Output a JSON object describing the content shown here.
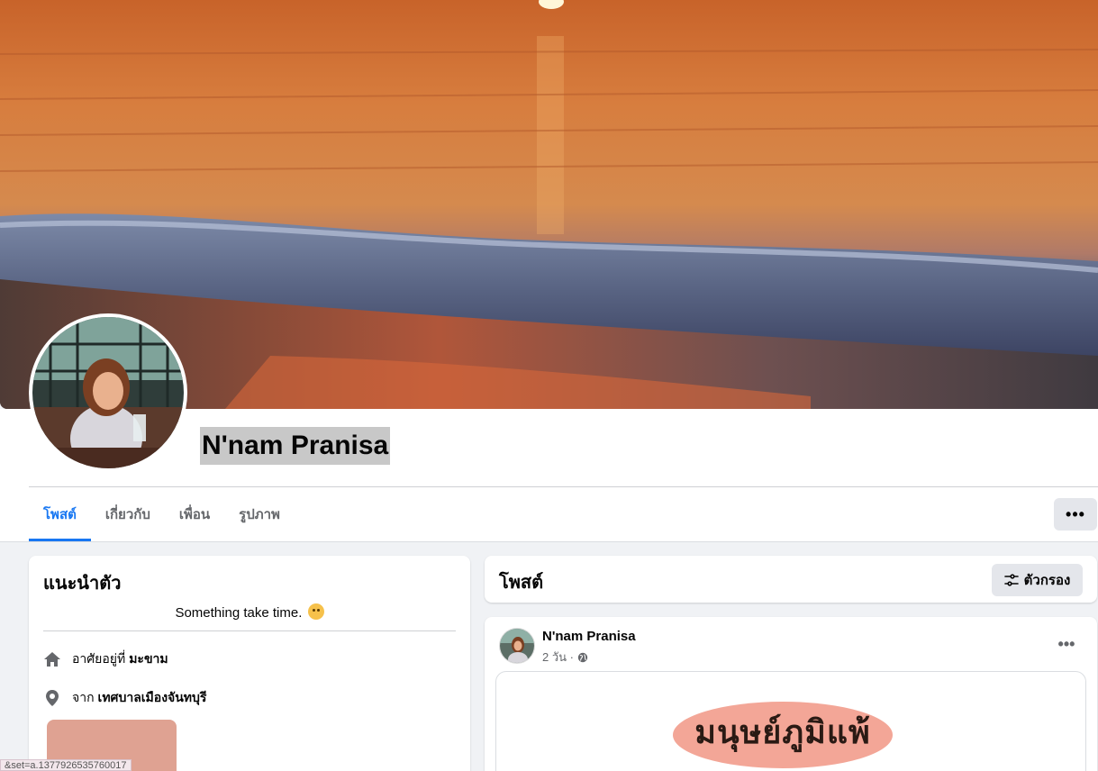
{
  "profile": {
    "name": "N'nam Pranisa"
  },
  "tabs": [
    {
      "label": "โพสต์"
    },
    {
      "label": "เกี่ยวกับ"
    },
    {
      "label": "เพื่อน"
    },
    {
      "label": "รูปภาพ"
    }
  ],
  "more_button": {
    "label": "•••"
  },
  "intro": {
    "title": "แนะนำตัว",
    "bio": "Something take time.",
    "bio_icon": "smiling-cat-emoji",
    "lives_in": {
      "prefix": "อาศัยอยู่ที่",
      "value": "มะขาม",
      "icon": "home-icon"
    },
    "from": {
      "prefix": "จาก",
      "value": "เทศบาลเมืองจันทบุรี",
      "icon": "location-pin-icon"
    }
  },
  "posts": {
    "title": "โพสต์",
    "filter_label": "ตัวกรอง",
    "filter_icon": "filter-sliders-icon",
    "items": [
      {
        "author": "N'nam Pranisa",
        "time": "2 วัน ·",
        "privacy_icon": "globe-icon",
        "more": "•••",
        "image_text": "มนุษย์ภูมิแพ้"
      }
    ]
  },
  "status_url": "&set=a.1377926535760017",
  "colors": {
    "accent": "#1877f2",
    "page_bg": "#f0f2f5",
    "button_bg": "#e4e6eb",
    "blob": "#f3a697"
  }
}
